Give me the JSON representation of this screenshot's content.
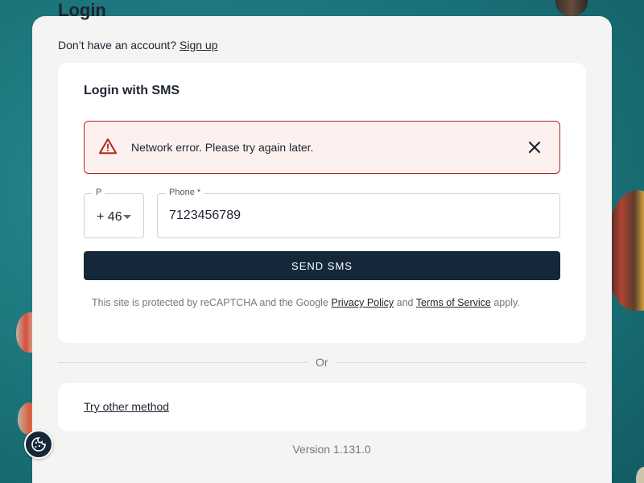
{
  "page": {
    "heading": "Login",
    "signup_prompt": "Don’t have an account?",
    "signup_link": "Sign up"
  },
  "sms": {
    "title": "Login with SMS",
    "alert": {
      "message": "Network error. Please try again later.",
      "icon": "warning-icon",
      "color": "#b3261e"
    },
    "prefix_label": "P",
    "prefix_value": "+ 46",
    "phone_label": "Phone *",
    "phone_value": "7123456789",
    "send_label": "SEND SMS",
    "recaptcha_prefix": "This site is protected by reCAPTCHA and the Google",
    "privacy_link": "Privacy Policy",
    "and_text": "and",
    "terms_link": "Terms of Service",
    "apply_text": "apply."
  },
  "divider": {
    "label": "Or"
  },
  "other": {
    "link": "Try other method"
  },
  "footer": {
    "version": "Version 1.131.0"
  },
  "colors": {
    "primary_button": "#14283a",
    "error": "#b3261e",
    "background": "#1f7a80"
  }
}
